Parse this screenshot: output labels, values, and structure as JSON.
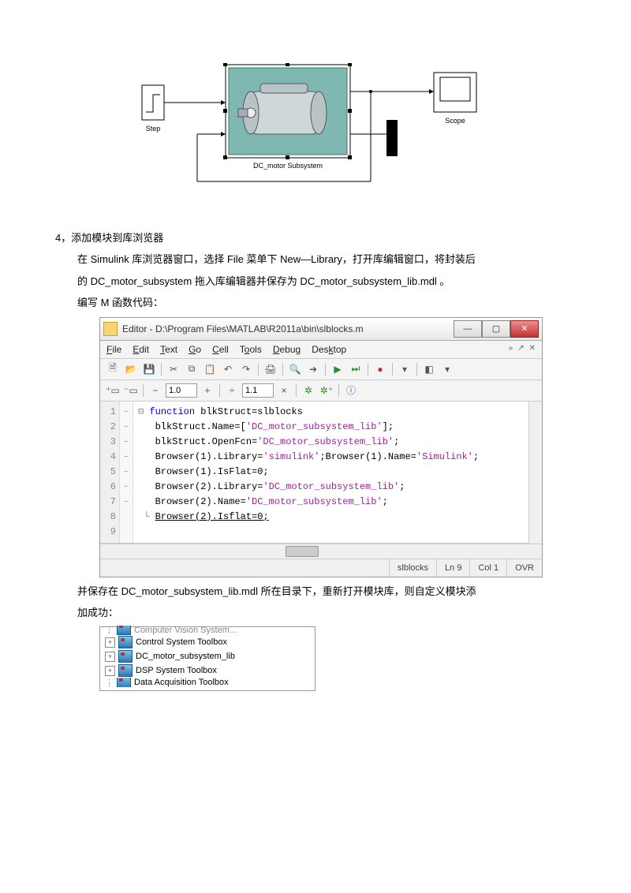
{
  "diagram": {
    "step_label": "Step",
    "subsystem_label": "DC_motor Subsystem",
    "scope_label": "Scope"
  },
  "section4": {
    "heading": "4，添加模块到库浏览器",
    "line1": "在 Simulink 库浏览器窗口，选择 File 菜单下 New—Library，打开库编辑窗口，将封装后",
    "line2": "的 DC_motor_subsystem 拖入库编辑器并保存为 DC_motor_subsystem_lib.mdl  。",
    "line3": "编写 M 函数代码：",
    "after1": "并保存在 DC_motor_subsystem_lib.mdl 所在目录下，重新打开模块库，则自定义模块添",
    "after2": "加成功："
  },
  "editor": {
    "title": "Editor - D:\\Program Files\\MATLAB\\R2011a\\bin\\slblocks.m",
    "menu": {
      "file": "File",
      "edit": "Edit",
      "text": "Text",
      "go": "Go",
      "cell": "Cell",
      "tools": "Tools",
      "debug": "Debug",
      "desktop": "Desktop"
    },
    "zoom1": "1.0",
    "zoom2": "1.1",
    "code": {
      "l1a": "function",
      "l1b": " blkStruct=slblocks",
      "l2a": "blkStruct.Name=[",
      "l2b": "'DC_motor_subsystem_lib'",
      "l2c": "];",
      "l3a": "blkStruct.OpenFcn=",
      "l3b": "'DC_motor_subsystem_lib'",
      "l3c": ";",
      "l4a": "Browser(1).Library=",
      "l4b": "'simulink'",
      "l4c": ";Browser(1).Name=",
      "l4d": "'Simulink'",
      "l4e": ";",
      "l5": "Browser(1).IsFlat=0;",
      "l6a": "Browser(2).Library=",
      "l6b": "'DC_motor_subsystem_lib'",
      "l6c": ";",
      "l7a": "Browser(2).Name=",
      "l7b": "'DC_motor_subsystem_lib'",
      "l7c": ";",
      "l8": "Browser(2).Isflat=0;"
    },
    "status": {
      "file": "slblocks",
      "ln": "Ln  9",
      "col": "Col  1",
      "ovr": "OVR"
    },
    "gutter": [
      "1",
      "2",
      "3",
      "4",
      "5",
      "6",
      "7",
      "8",
      "9"
    ],
    "gutter2": [
      "",
      "–",
      "–",
      "–",
      "–",
      "–",
      "–",
      "–",
      ""
    ]
  },
  "tree": {
    "items": [
      {
        "label": "Computer Vision System..."
      },
      {
        "label": "Control System Toolbox"
      },
      {
        "label": "DC_motor_subsystem_lib"
      },
      {
        "label": "DSP System Toolbox"
      },
      {
        "label": "Data Acquisition Toolbox"
      }
    ]
  }
}
